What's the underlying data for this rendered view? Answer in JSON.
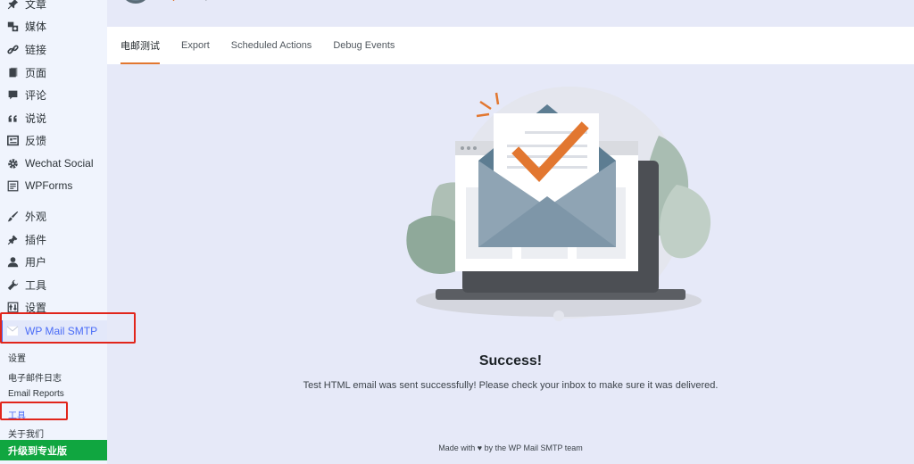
{
  "header": {
    "brand_prefix": "a",
    "brand_name": "wpforms",
    "brand_suffix": "product"
  },
  "sidebar": {
    "items": [
      {
        "label": "文章",
        "icon": "pin-icon"
      },
      {
        "label": "媒体",
        "icon": "media-icon"
      },
      {
        "label": "链接",
        "icon": "link-icon"
      },
      {
        "label": "页面",
        "icon": "page-icon"
      },
      {
        "label": "评论",
        "icon": "comment-icon"
      },
      {
        "label": "说说",
        "icon": "quote-icon"
      },
      {
        "label": "反馈",
        "icon": "feedback-icon"
      },
      {
        "label": "Wechat Social",
        "icon": "gear-icon"
      },
      {
        "label": "WPForms",
        "icon": "form-icon"
      },
      {
        "label": "外观",
        "icon": "brush-icon"
      },
      {
        "label": "插件",
        "icon": "plugin-icon"
      },
      {
        "label": "用户",
        "icon": "user-icon"
      },
      {
        "label": "工具",
        "icon": "wrench-icon"
      },
      {
        "label": "设置",
        "icon": "settings-icon"
      },
      {
        "label": "WP Mail SMTP",
        "icon": "mail-icon"
      }
    ],
    "submenu": [
      {
        "label": "设置"
      },
      {
        "label": "电子邮件日志"
      },
      {
        "label": "Email Reports"
      },
      {
        "label": "工具"
      },
      {
        "label": "关于我们"
      }
    ],
    "upgrade_label": "升级到专业版"
  },
  "tabs": [
    {
      "label": "电邮测试",
      "active": true
    },
    {
      "label": "Export",
      "active": false
    },
    {
      "label": "Scheduled Actions",
      "active": false
    },
    {
      "label": "Debug Events",
      "active": false
    }
  ],
  "main": {
    "success_title": "Success!",
    "success_message": "Test HTML email was sent successfully! Please check your inbox to make sure it was delivered."
  },
  "footer": {
    "made_with": "Made with",
    "heart": "♥",
    "by_text": "by the WP Mail SMTP team"
  },
  "colors": {
    "accent": "#4a6cf7",
    "brand_orange": "#e27730",
    "upgrade_green": "#10a640",
    "highlight_red": "#e1251b"
  }
}
